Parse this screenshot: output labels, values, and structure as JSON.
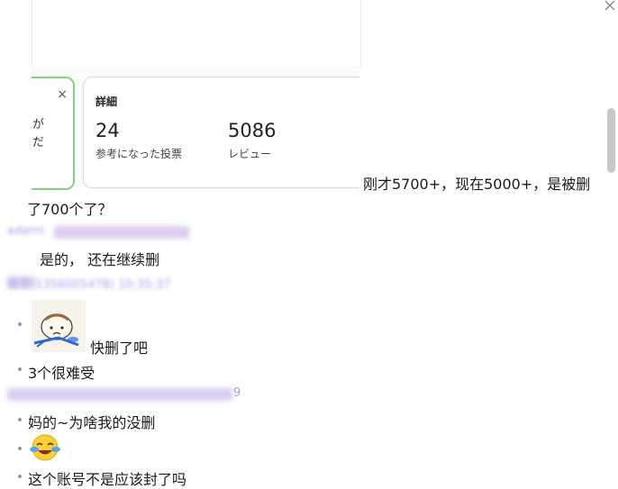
{
  "embedded_screenshot": {
    "card_close": "×",
    "card_partial_text": [
      "が",
      "だ"
    ],
    "detail_title": "詳細",
    "stats": [
      {
        "value": "24",
        "label": "参考になった投票"
      },
      {
        "value": "5086",
        "label": "レビュー"
      }
    ]
  },
  "messages": {
    "msg1_line1": "刚才5700+，现在5000+，是被删",
    "msg1_line2": "了700个了？",
    "user2_name": "adam(",
    "msg2": "是的， 还在继续删",
    "user3_name": "墨言(1356005478) 10:35:37",
    "msg3": "快删了吧",
    "msg4": "3个很难受",
    "user4_name": "9",
    "msg5": "妈的~为啥我的没删",
    "msg7": "这个账号不是应该封了吗"
  },
  "icons": {
    "window_close": "close-icon",
    "sticker1": "crying-cartoon-sticker",
    "sticker2": "crying-laughing-emoji"
  }
}
